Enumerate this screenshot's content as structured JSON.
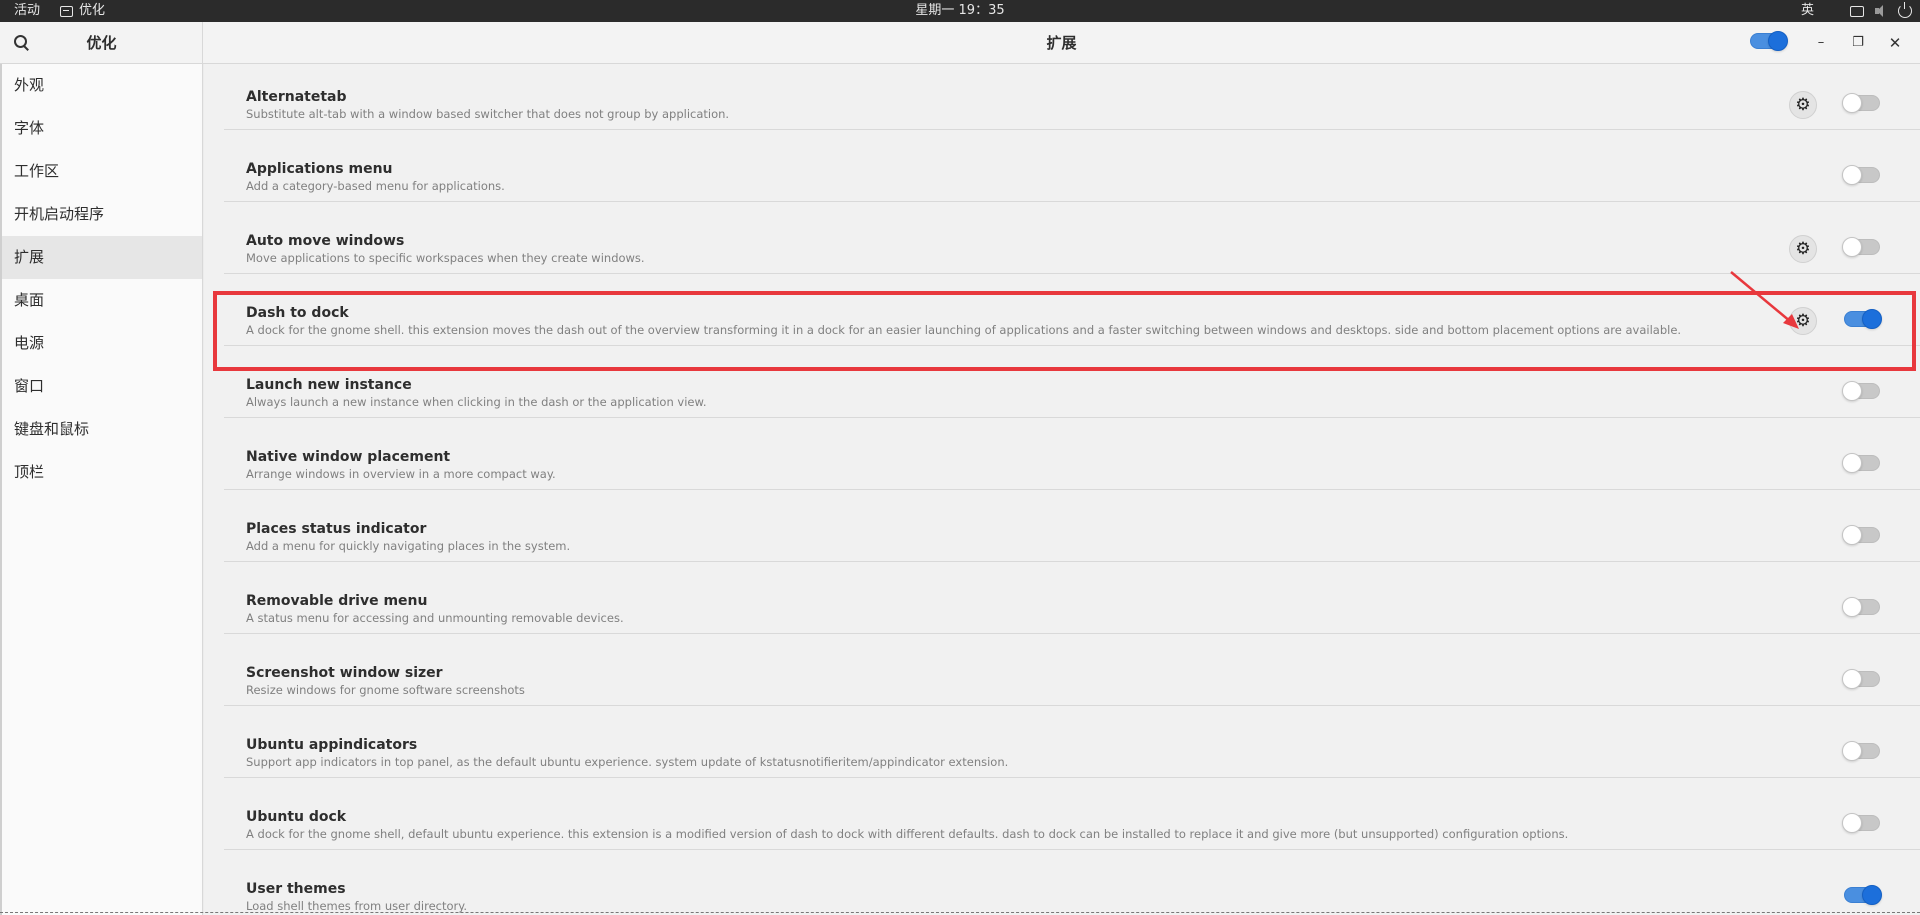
{
  "topbar": {
    "activities": "活动",
    "app_name": "优化",
    "clock": "星期一 19：35",
    "input_method": "英"
  },
  "header": {
    "app_title": "优化",
    "page_title": "扩展",
    "global_toggle_on": true,
    "minimize": "–",
    "restore": "❐",
    "close": "✕"
  },
  "sidebar": {
    "items": [
      {
        "label": "外观"
      },
      {
        "label": "字体"
      },
      {
        "label": "工作区"
      },
      {
        "label": "开机启动程序"
      },
      {
        "label": "扩展"
      },
      {
        "label": "桌面"
      },
      {
        "label": "电源"
      },
      {
        "label": "窗口"
      },
      {
        "label": "键盘和鼠标"
      },
      {
        "label": "顶栏"
      }
    ],
    "active_index": 4
  },
  "extensions": [
    {
      "name": "Alternatetab",
      "desc": "Substitute alt-tab with a window based switcher that does not group by application.",
      "has_settings": true,
      "enabled": false
    },
    {
      "name": "Applications menu",
      "desc": "Add a category-based menu for applications.",
      "has_settings": false,
      "enabled": false
    },
    {
      "name": "Auto move windows",
      "desc": "Move applications to specific workspaces when they create windows.",
      "has_settings": true,
      "enabled": false
    },
    {
      "name": "Dash to dock",
      "desc": "A dock for the gnome shell. this extension moves the dash out of the overview transforming it in a dock for an easier launching of applications and a faster switching between windows and desktops. side and bottom placement options are available.",
      "has_settings": true,
      "enabled": true
    },
    {
      "name": "Launch new instance",
      "desc": "Always launch a new instance when clicking in the dash or the application view.",
      "has_settings": false,
      "enabled": false
    },
    {
      "name": "Native window placement",
      "desc": "Arrange windows in overview in a more compact way.",
      "has_settings": false,
      "enabled": false
    },
    {
      "name": "Places status indicator",
      "desc": "Add a menu for quickly navigating places in the system.",
      "has_settings": false,
      "enabled": false
    },
    {
      "name": "Removable drive menu",
      "desc": "A status menu for accessing and unmounting removable devices.",
      "has_settings": false,
      "enabled": false
    },
    {
      "name": "Screenshot window sizer",
      "desc": "Resize windows for gnome software screenshots",
      "has_settings": false,
      "enabled": false
    },
    {
      "name": "Ubuntu appindicators",
      "desc": "Support app indicators in top panel, as the default ubuntu experience. system update of kstatusnotifieritem/appindicator extension.",
      "has_settings": false,
      "enabled": false
    },
    {
      "name": "Ubuntu dock",
      "desc": "A dock for the gnome shell, default ubuntu experience. this extension is a modified version of dash to dock with different defaults. dash to dock can be installed to replace it and give more (but unsupported) configuration options.",
      "has_settings": false,
      "enabled": false
    },
    {
      "name": "User themes",
      "desc": "Load shell themes from user directory.",
      "has_settings": false,
      "enabled": true
    }
  ],
  "icons": {
    "settings": "gear-icon",
    "search": "search-icon"
  },
  "colors": {
    "accent": "#1c6fdb",
    "highlight": "#e8383d"
  }
}
